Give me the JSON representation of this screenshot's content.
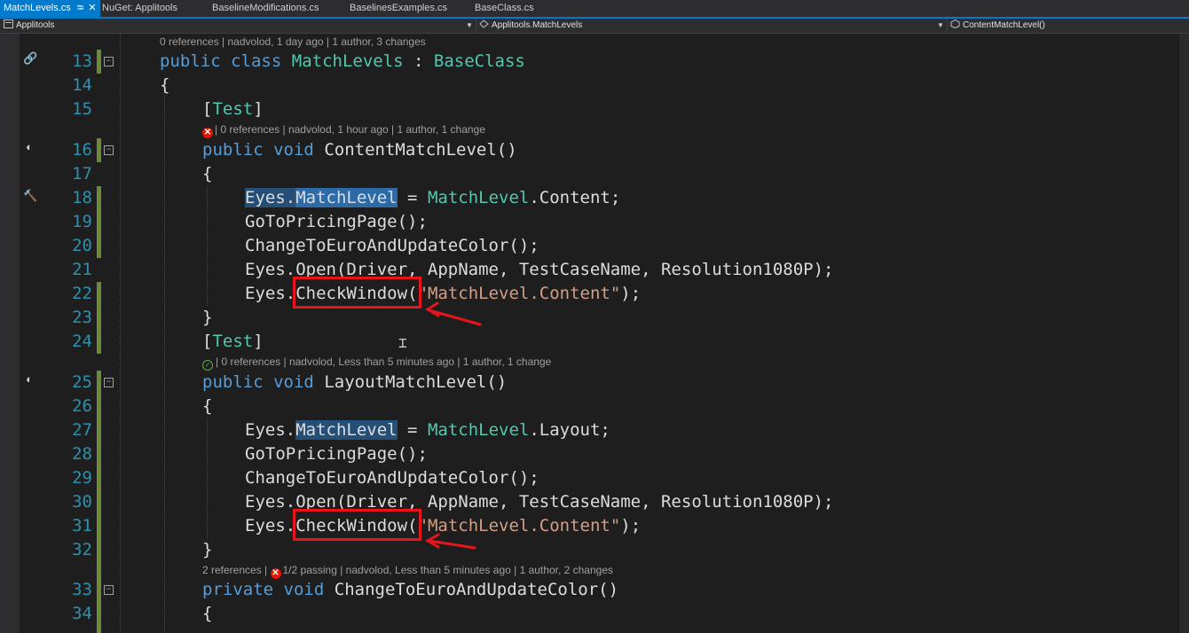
{
  "tabs": [
    {
      "label": "MatchLevels.cs",
      "active": true
    },
    {
      "label": "NuGet: Applitools"
    },
    {
      "label": "BaselineModifications.cs"
    },
    {
      "label": "BaselinesExamples.cs"
    },
    {
      "label": "BaseClass.cs"
    }
  ],
  "navbar": {
    "project": "Applitools",
    "type": "Applitools.MatchLevels",
    "member": "ContentMatchLevel()"
  },
  "lens": {
    "class": "0 references | nadvolod, 1 day ago | 1 author, 3 changes",
    "content_method": "| 0 references | nadvolod, 1 hour ago | 1 author, 1 change",
    "layout_method": "| 0 references | nadvolod, Less than 5 minutes ago | 1 author, 1 change",
    "private_refs": "2 references | ",
    "private_rest": "1/2 passing | nadvolod, Less than 5 minutes ago | 1 author, 2 changes"
  },
  "lines": {
    "13": "13",
    "14": "14",
    "15": "15",
    "16": "16",
    "17": "17",
    "18": "18",
    "19": "19",
    "20": "20",
    "21": "21",
    "22": "22",
    "23": "23",
    "24": "24",
    "25": "25",
    "26": "26",
    "27": "27",
    "28": "28",
    "29": "29",
    "30": "30",
    "31": "31",
    "32": "32",
    "33": "33",
    "34": "34"
  },
  "code": {
    "public": "public",
    "class": "class",
    "void": "void",
    "private": "private",
    "class_name": "MatchLevels",
    "colon": " : ",
    "base_class": "BaseClass",
    "open_brace": "{",
    "close_brace": "}",
    "attr_open": "[",
    "attr_name": "Test",
    "attr_close": "]",
    "content_method": "ContentMatchLevel()",
    "layout_method": "LayoutMatchLevel()",
    "private_method": "ChangeToEuroAndUpdateColor()",
    "eyes": "Eyes",
    "dot": ".",
    "matchlevel_prop": "MatchLevel",
    "assign": " = ",
    "matchlevel_type": "MatchLevel",
    "content": "Content;",
    "layout": "Layout;",
    "goto": "GoToPricingPage();",
    "change": "ChangeToEuroAndUpdateColor();",
    "open_call": "Eyes.Open(Driver, AppName, TestCaseName, Resolution1080P);",
    "checkwindow": "CheckWindow",
    "paren_open": "(",
    "string_arg": "\"MatchLevel.Content\"",
    "paren_close": ");"
  },
  "colors": {
    "background": "#1e1e1e",
    "keyword": "#569cd6",
    "type": "#4ec9b0",
    "string": "#d69d85",
    "line_number": "#2b91af",
    "annotation": "#e8141c",
    "accent": "#007acc"
  },
  "icons": {
    "tab_pin": "pin-icon",
    "tab_close": "close-icon",
    "lens_fail": "failed-test-icon",
    "lens_pass": "passed-test-icon"
  }
}
